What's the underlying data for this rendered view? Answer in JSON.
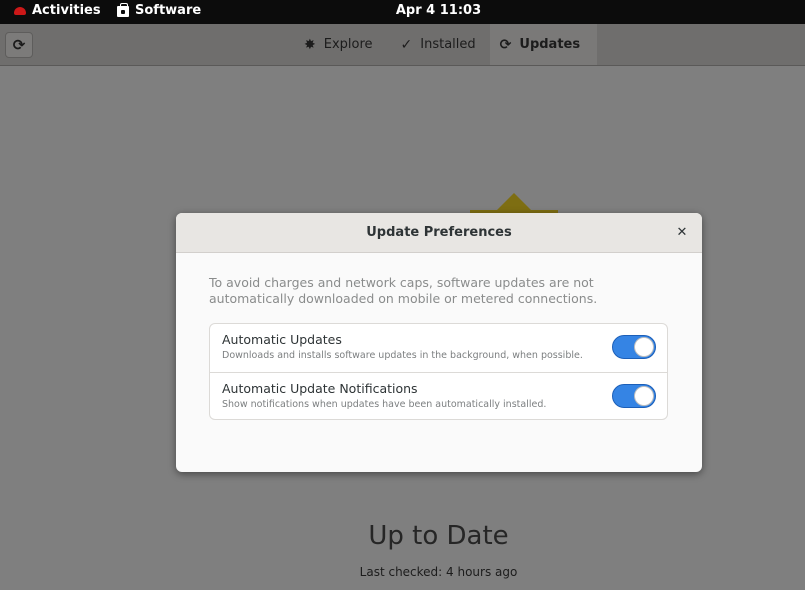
{
  "topbar": {
    "activities_label": "Activities",
    "app_label": "Software",
    "clock": "Apr 4  11:03"
  },
  "header": {
    "refresh_icon": "refresh-icon",
    "tabs": [
      {
        "label": "Explore",
        "icon": "star-icon"
      },
      {
        "label": "Installed",
        "icon": "check-circle-icon"
      },
      {
        "label": "Updates",
        "icon": "refresh-icon",
        "active": true
      }
    ]
  },
  "main": {
    "status_title": "Up to Date",
    "last_checked": "Last checked: 4 hours ago"
  },
  "dialog": {
    "title": "Update Preferences",
    "close_icon": "close-icon",
    "description": "To avoid charges and network caps, software updates are not automatically downloaded on mobile or metered connections.",
    "preferences": [
      {
        "title": "Automatic Updates",
        "subtitle": "Downloads and installs software updates in the background, when possible.",
        "enabled": true
      },
      {
        "title": "Automatic Update Notifications",
        "subtitle": "Show notifications when updates have been automatically installed.",
        "enabled": true
      }
    ]
  },
  "colors": {
    "switch_on": "#3584e4",
    "topbar": "#0c0c0c",
    "brand_hat": "#cc1818"
  }
}
